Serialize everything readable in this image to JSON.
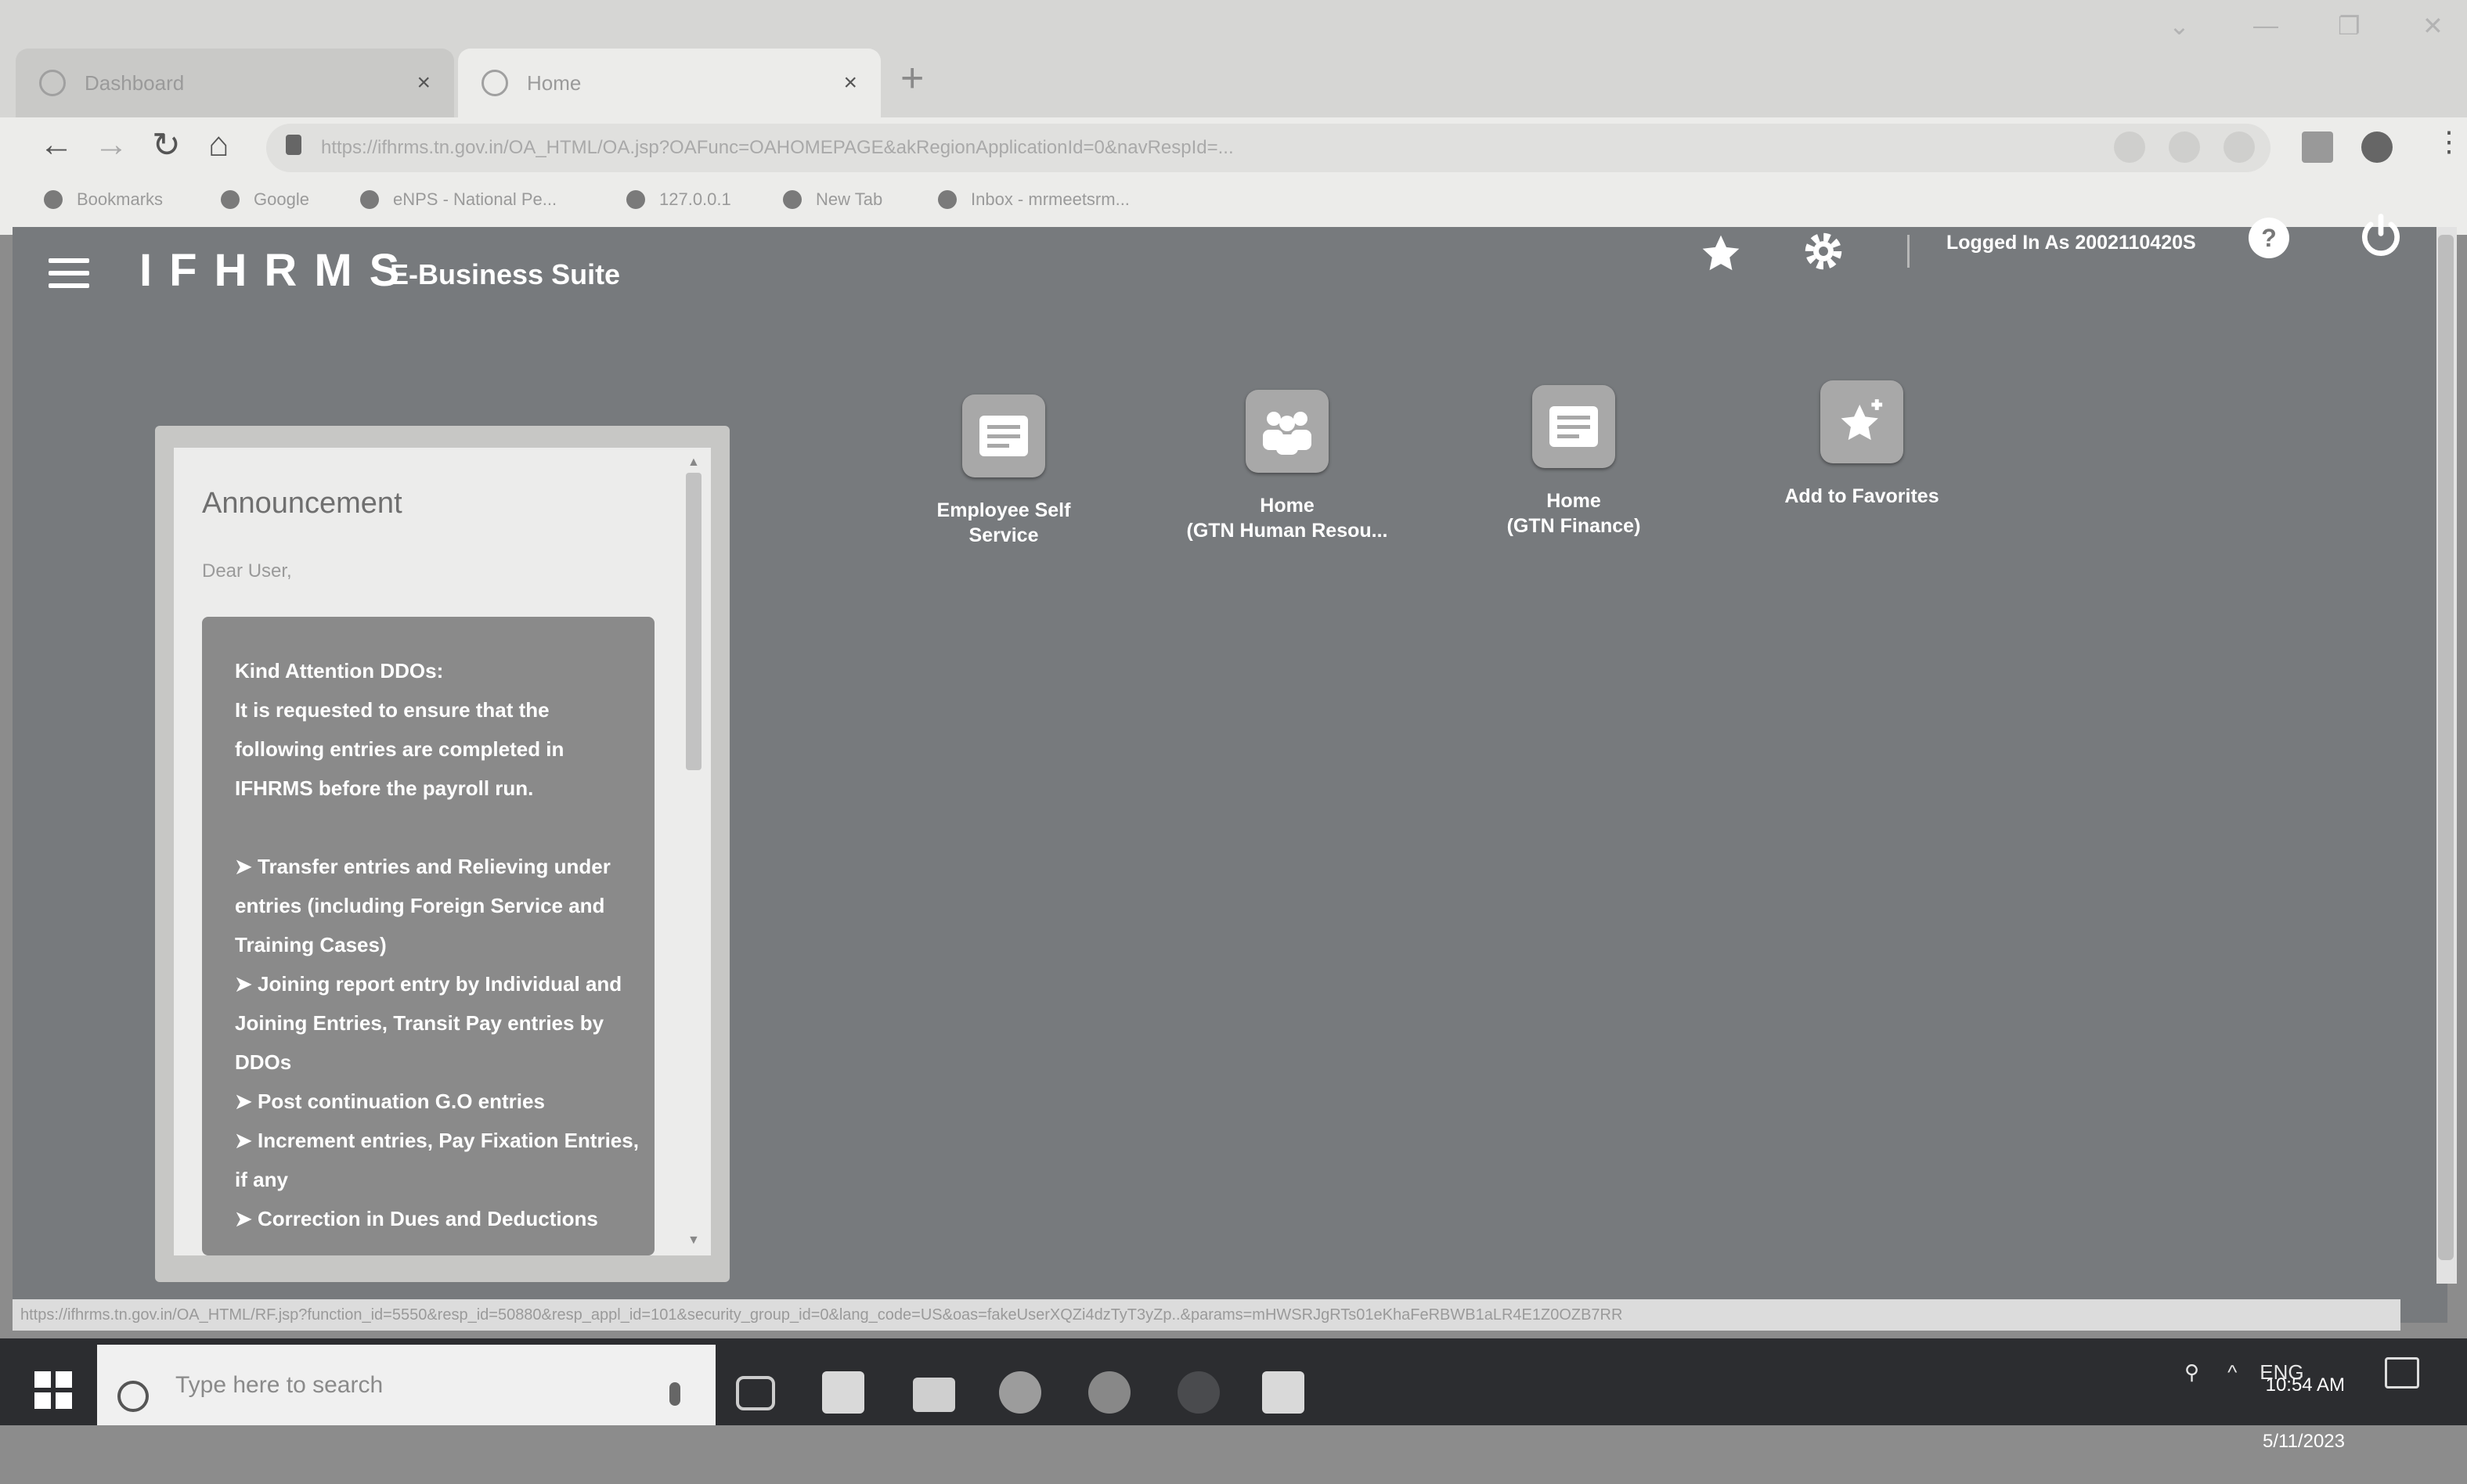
{
  "browser": {
    "tabs": [
      {
        "label": "Dashboard"
      },
      {
        "label": "Home"
      }
    ],
    "new_tab": "+",
    "address": "https://ifhrms.tn.gov.in/OA_HTML/OA.jsp?OAFunc=OAHOMEPAGE&akRegionApplicationId=0&navRespId=...",
    "bookmarks": [
      {
        "label": "Bookmarks"
      },
      {
        "label": "Google"
      },
      {
        "label": "eNPS - National Pe..."
      },
      {
        "label": "127.0.0.1"
      },
      {
        "label": "New Tab"
      },
      {
        "label": "Inbox - mrmeetsrm..."
      }
    ],
    "status_url": "https://ifhrms.tn.gov.in/OA_HTML/RF.jsp?function_id=5550&resp_id=50880&resp_appl_id=101&security_group_id=0&lang_code=US&oas=fakeUserXQZi4dzTyT3yZp..&params=mHWSRJgRTs01eKhaFeRBWB1aLR4E1Z0OZB7RR"
  },
  "header": {
    "app_name": "IFHRMS",
    "suite": "E-Business Suite",
    "logged_in": "Logged In As 2002110420S",
    "help": "?"
  },
  "apps": [
    {
      "label": "Employee Self\nService"
    },
    {
      "label": "Home\n(GTN Human Resou..."
    },
    {
      "label": "Home\n(GTN Finance)"
    },
    {
      "label": "Add to Favorites"
    }
  ],
  "announcement": {
    "title": "Announcement",
    "greeting": "Dear User,",
    "message": "Kind Attention DDOs:\nIt is requested to ensure that the following entries are completed in IFHRMS before the payroll run.\n\n➤ Transfer entries and Relieving under entries (including Foreign Service and Training Cases)\n➤ Joining report entry by Individual and Joining Entries, Transit Pay entries by DDOs\n➤ Post continuation G.O entries\n➤ Increment entries, Pay Fixation Entries, if any\n➤ Correction in Dues and Deductions"
  },
  "taskbar": {
    "search_placeholder": "Type here to search",
    "lang": "ENG",
    "time": "10:54 AM",
    "date": "5/11/2023"
  },
  "colors": {
    "app_bg": "#777a7d",
    "announcement_box": "#8a8a8a",
    "taskbar": "#2c2d30"
  }
}
